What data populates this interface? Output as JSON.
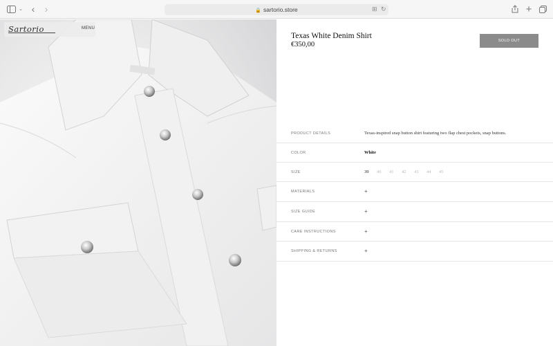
{
  "browser": {
    "url": "sartorio.store",
    "icons": [
      "sidebar-icon",
      "chevron-down-icon",
      "back-icon",
      "forward-icon",
      "translate-icon",
      "reload-icon",
      "share-icon",
      "new-tab-icon",
      "tabs-icon"
    ]
  },
  "site": {
    "logo": "Sartorio",
    "menu_label": "MENU"
  },
  "product": {
    "title": "Texas White Denim Shirt",
    "price": "€350,00",
    "button_label": "SOLD OUT",
    "button_color": "#8b8b8b"
  },
  "details": {
    "product_details": {
      "label": "PRODUCT DETAILS",
      "value": "Texas-inspired snap button shirt featuring two flap chest pockets, snap buttons."
    },
    "color": {
      "label": "COLOR",
      "value": "White"
    },
    "size": {
      "label": "SIZE",
      "options": [
        "39",
        "40",
        "41",
        "42",
        "43",
        "44",
        "45"
      ],
      "selected": "39"
    },
    "materials": {
      "label": "MATERIALS",
      "toggle": "+"
    },
    "size_guide": {
      "label": "SIZE GUIDE",
      "toggle": "+"
    },
    "care": {
      "label": "CARE INSTRUCTIONS",
      "toggle": "+"
    },
    "shipping": {
      "label": "SHIPPING & RETURNS",
      "toggle": "+"
    }
  }
}
